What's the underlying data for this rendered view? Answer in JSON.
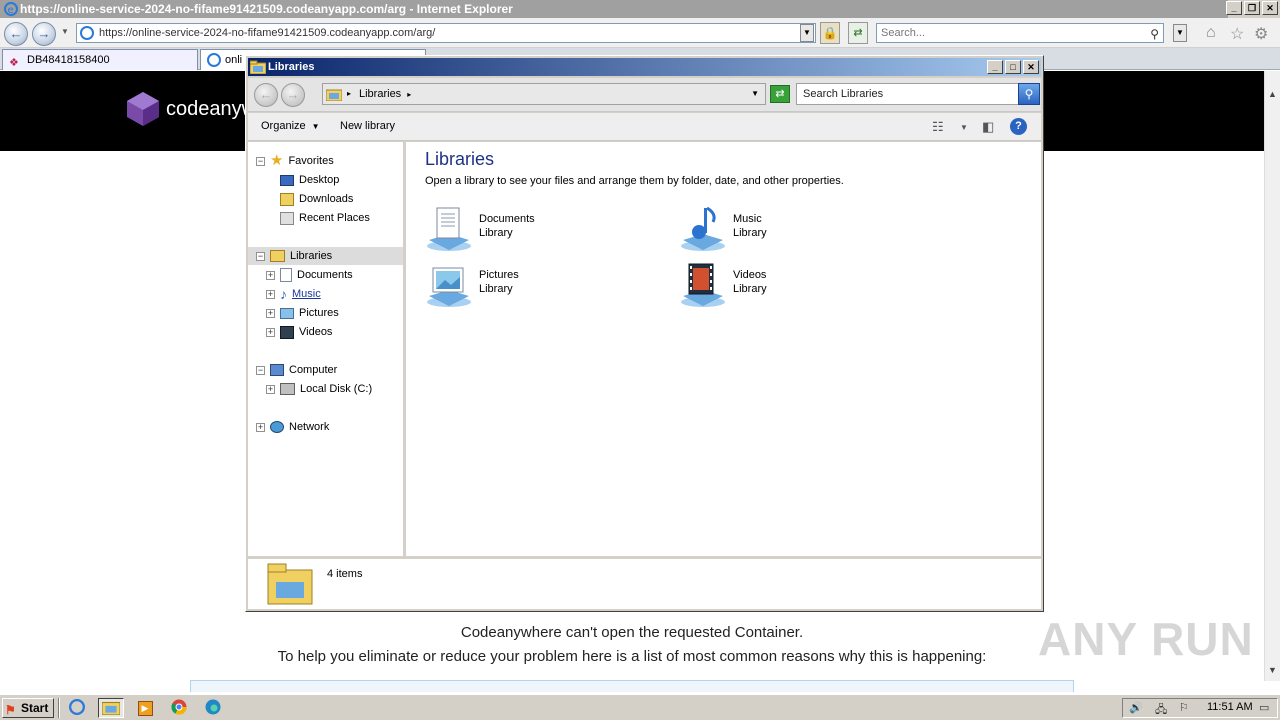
{
  "ie": {
    "window_title": "https://online-service-2024-no-fifame91421509.codeanyapp.com/arg - Internet Explorer",
    "address": "https://online-service-2024-no-fifame91421509.codeanyapp.com/arg/",
    "search_placeholder": "Search...",
    "tabs": [
      {
        "label": "DB48418158400"
      },
      {
        "label": "onli"
      }
    ]
  },
  "page": {
    "brand": "codeanyw",
    "message_line1": "Codeanywhere can't open the requested Container.",
    "message_line2": "To help you eliminate or reduce your problem here is a list of most common reasons why this is happening:",
    "watermark": "ANY RUN"
  },
  "explorer": {
    "title": "Libraries",
    "breadcrumb": "Libraries",
    "search_placeholder": "Search Libraries",
    "toolbar": {
      "organize": "Organize",
      "new_library": "New library"
    },
    "nav": {
      "favorites": "Favorites",
      "desktop": "Desktop",
      "downloads": "Downloads",
      "recent_places": "Recent Places",
      "libraries": "Libraries",
      "documents": "Documents",
      "music": "Music",
      "pictures": "Pictures",
      "videos": "Videos",
      "computer": "Computer",
      "local_disk": "Local Disk (C:)",
      "network": "Network"
    },
    "heading": "Libraries",
    "subheading": "Open a library to see your files and arrange them by folder, date, and other properties.",
    "libraries": [
      {
        "name": "Documents",
        "type": "Library",
        "icon": "documents-library-icon"
      },
      {
        "name": "Music",
        "type": "Library",
        "icon": "music-library-icon"
      },
      {
        "name": "Pictures",
        "type": "Library",
        "icon": "pictures-library-icon"
      },
      {
        "name": "Videos",
        "type": "Library",
        "icon": "videos-library-icon"
      }
    ],
    "status": "4 items"
  },
  "taskbar": {
    "start": "Start",
    "clock": "11:51 AM"
  },
  "colors": {
    "titlebar_start": "#0a246a",
    "titlebar_end": "#a6caf0",
    "heading_blue": "#1e3287",
    "page_header": "#000000"
  }
}
